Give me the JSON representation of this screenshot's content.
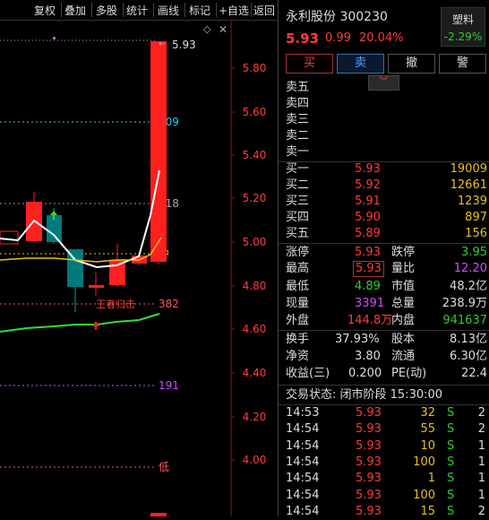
{
  "toolbar": {
    "buttons": [
      "复权",
      "叠加",
      "多股",
      "统计",
      "画线",
      "标记",
      "+自选",
      "返回"
    ]
  },
  "chart": {
    "price_labels": [
      "5.80",
      "5.60",
      "5.40",
      "5.20",
      "5.00",
      "4.80",
      "4.60",
      "4.40",
      "4.20",
      "4.00"
    ],
    "fib_levels": [
      {
        "label": "809",
        "color": "#33ccee"
      },
      {
        "label": "618",
        "color": "#aaaaaa"
      },
      {
        "label": "中",
        "color": "#e6c21c"
      },
      {
        "label": "382",
        "color": "#ff5555"
      },
      {
        "label": "191",
        "color": "#d44cff"
      },
      {
        "label": "低",
        "color": "#ff5555"
      }
    ],
    "high_label": "5.93",
    "annotation": "王者归击",
    "colors": {
      "up": "#ff2020",
      "down": "#00a0a0",
      "ma_white": "#ffffff",
      "ma_yellow": "#e6c21c",
      "ma_green": "#33dd33"
    }
  },
  "quote": {
    "name": "永利股份",
    "code": "300230",
    "sector": "塑料",
    "sector_pct": "-2.29%",
    "price": "5.93",
    "change": "0.99",
    "change_pct": "20.04%",
    "buttons": [
      "买",
      "卖",
      "撤",
      "警"
    ],
    "asks": [
      {
        "label": "卖五"
      },
      {
        "label": "卖四"
      },
      {
        "label": "卖三"
      },
      {
        "label": "卖二"
      },
      {
        "label": "卖一"
      }
    ],
    "bids": [
      {
        "label": "买一",
        "price": "5.93",
        "vol": "19009"
      },
      {
        "label": "买二",
        "price": "5.92",
        "vol": "12661"
      },
      {
        "label": "买三",
        "price": "5.91",
        "vol": "1239"
      },
      {
        "label": "买四",
        "price": "5.90",
        "vol": "897"
      },
      {
        "label": "买五",
        "price": "5.89",
        "vol": "156"
      }
    ],
    "stats": {
      "limit_up_label": "涨停",
      "limit_up": "5.93",
      "limit_down_label": "跌停",
      "limit_down": "3.95",
      "high_label": "最高",
      "high": "5.93",
      "vol_ratio_label": "量比",
      "vol_ratio": "12.20",
      "low_label": "最低",
      "low": "4.89",
      "mkt_cap_label": "市值",
      "mkt_cap": "48.2亿",
      "cur_vol_label": "现量",
      "cur_vol": "3391",
      "total_vol_label": "总量",
      "total_vol": "238.9万",
      "outer_label": "外盘",
      "outer": "144.8万",
      "inner_label": "内盘",
      "inner": "941637",
      "turnover_label": "换手",
      "turnover": "37.93%",
      "shares_label": "股本",
      "shares": "8.13亿",
      "nav_label": "净资",
      "nav": "3.80",
      "float_label": "流通",
      "float": "6.30亿",
      "eps_label": "收益(三)",
      "eps": "0.200",
      "pe_label": "PE(动)",
      "pe": "22.4"
    },
    "trade_status": "交易状态: 闭市阶段 15:30:00",
    "ticks": [
      {
        "time": "14:53",
        "price": "5.93",
        "vol": "32",
        "side": "S",
        "count": "2"
      },
      {
        "time": "14:54",
        "price": "5.93",
        "vol": "55",
        "side": "S",
        "count": "2"
      },
      {
        "time": "14:54",
        "price": "5.93",
        "vol": "10",
        "side": "S",
        "count": "1"
      },
      {
        "time": "14:54",
        "price": "5.93",
        "vol": "100",
        "side": "S",
        "count": "1"
      },
      {
        "time": "14:54",
        "price": "5.93",
        "vol": "1",
        "side": "S",
        "count": "1"
      },
      {
        "time": "14:54",
        "price": "5.93",
        "vol": "100",
        "side": "S",
        "count": "1"
      },
      {
        "time": "14:54",
        "price": "5.93",
        "vol": "15",
        "side": "S",
        "count": "2"
      }
    ]
  }
}
